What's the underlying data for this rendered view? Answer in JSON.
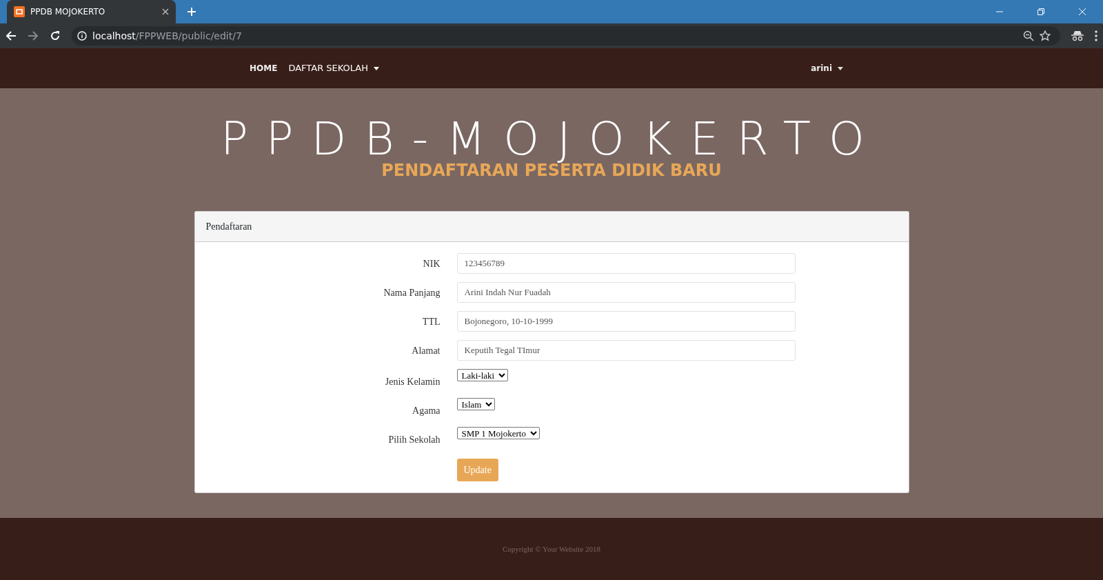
{
  "browser": {
    "tab_title": "PPDB MOJOKERTO",
    "url_host": "localhost",
    "url_path": "/FPPWEB/public/edit/7"
  },
  "navbar": {
    "items": [
      {
        "label": "HOME",
        "kind": "link"
      },
      {
        "label": "DAFTAR SEKOLAH",
        "kind": "dropdown"
      }
    ],
    "user": "arini"
  },
  "hero": {
    "title": "PPDB-MOJOKERTO",
    "subtitle": "PENDAFTARAN PESERTA DIDIK BARU"
  },
  "card": {
    "header": "Pendaftaran",
    "fields": [
      {
        "label": "NIK",
        "kind": "text",
        "value": "123456789"
      },
      {
        "label": "Nama Panjang",
        "kind": "text",
        "value": "Arini Indah Nur Fuadah"
      },
      {
        "label": "TTL",
        "kind": "text",
        "value": "Bojonegoro, 10-10-1999"
      },
      {
        "label": "Alamat",
        "kind": "text",
        "value": "Keputih Tegal TImur"
      },
      {
        "label": "Jenis Kelamin",
        "kind": "select",
        "value": "Laki-laki"
      },
      {
        "label": "Agama",
        "kind": "select",
        "value": "Islam"
      },
      {
        "label": "Pilih Sekolah",
        "kind": "select",
        "value": "SMP 1 Mojokerto"
      }
    ],
    "submit": "Update"
  },
  "footer": "Copyright © Your Website 2018"
}
